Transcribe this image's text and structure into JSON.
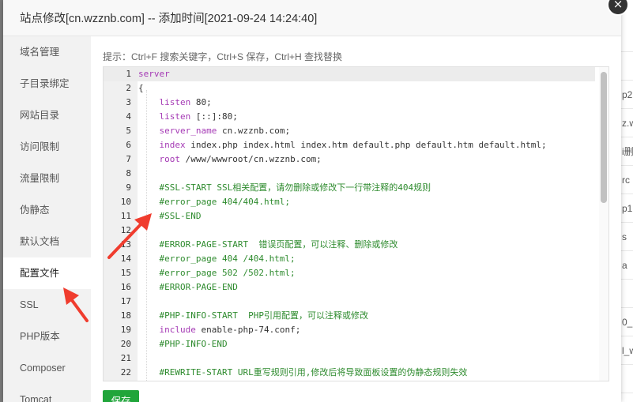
{
  "dialog": {
    "title": "站点修改[cn.wzznb.com] -- 添加时间[2021-09-24 14:24:40]",
    "close_label": "×"
  },
  "sidebar": {
    "items": [
      {
        "label": "域名管理"
      },
      {
        "label": "子目录绑定"
      },
      {
        "label": "网站目录"
      },
      {
        "label": "访问限制"
      },
      {
        "label": "流量限制"
      },
      {
        "label": "伪静态"
      },
      {
        "label": "默认文档"
      },
      {
        "label": "配置文件",
        "active": true
      },
      {
        "label": "SSL"
      },
      {
        "label": "PHP版本"
      },
      {
        "label": "Composer"
      },
      {
        "label": "Tomcat"
      }
    ]
  },
  "editor": {
    "hint": "提示：Ctrl+F 搜索关键字，Ctrl+S 保存，Ctrl+H 查找替换",
    "current_line": 1,
    "lines": [
      {
        "n": "1",
        "text": "server"
      },
      {
        "n": "2",
        "text": "{"
      },
      {
        "n": "3",
        "text": "    listen 80;"
      },
      {
        "n": "4",
        "text": "    listen [::]:80;"
      },
      {
        "n": "5",
        "text": "    server_name cn.wzznb.com;"
      },
      {
        "n": "6",
        "text": "    index index.php index.html index.htm default.php default.htm default.html;"
      },
      {
        "n": "7",
        "text": "    root /www/wwwroot/cn.wzznb.com;"
      },
      {
        "n": "8",
        "text": ""
      },
      {
        "n": "9",
        "text": "    #SSL-START SSL相关配置，请勿删除或修改下一行带注释的404规则"
      },
      {
        "n": "10",
        "text": "    #error_page 404/404.html;"
      },
      {
        "n": "11",
        "text": "    #SSL-END"
      },
      {
        "n": "12",
        "text": ""
      },
      {
        "n": "13",
        "text": "    #ERROR-PAGE-START  错误页配置，可以注释、删除或修改"
      },
      {
        "n": "14",
        "text": "    #error_page 404 /404.html;"
      },
      {
        "n": "15",
        "text": "    #error_page 502 /502.html;"
      },
      {
        "n": "16",
        "text": "    #ERROR-PAGE-END"
      },
      {
        "n": "17",
        "text": ""
      },
      {
        "n": "18",
        "text": "    #PHP-INFO-START  PHP引用配置，可以注释或修改"
      },
      {
        "n": "19",
        "text": "    include enable-php-74.conf;"
      },
      {
        "n": "20",
        "text": "    #PHP-INFO-END"
      },
      {
        "n": "21",
        "text": ""
      },
      {
        "n": "22",
        "text": "    #REWRITE-START URL重写规则引用,修改后将导致面板设置的伪静态规则失效"
      }
    ]
  },
  "save_button": {
    "label": "保存"
  },
  "background_page": {
    "rows": [
      "",
      "",
      "p2",
      "z.w",
      "i删",
      "rc",
      "p1",
      "s",
      "a",
      "",
      "0_",
      "l_w",
      "",
      ""
    ]
  },
  "colors": {
    "primary": "#20a53a",
    "keyword": "#a53ab5",
    "comment": "#2e8b2e",
    "arrow": "#f03c2e"
  }
}
